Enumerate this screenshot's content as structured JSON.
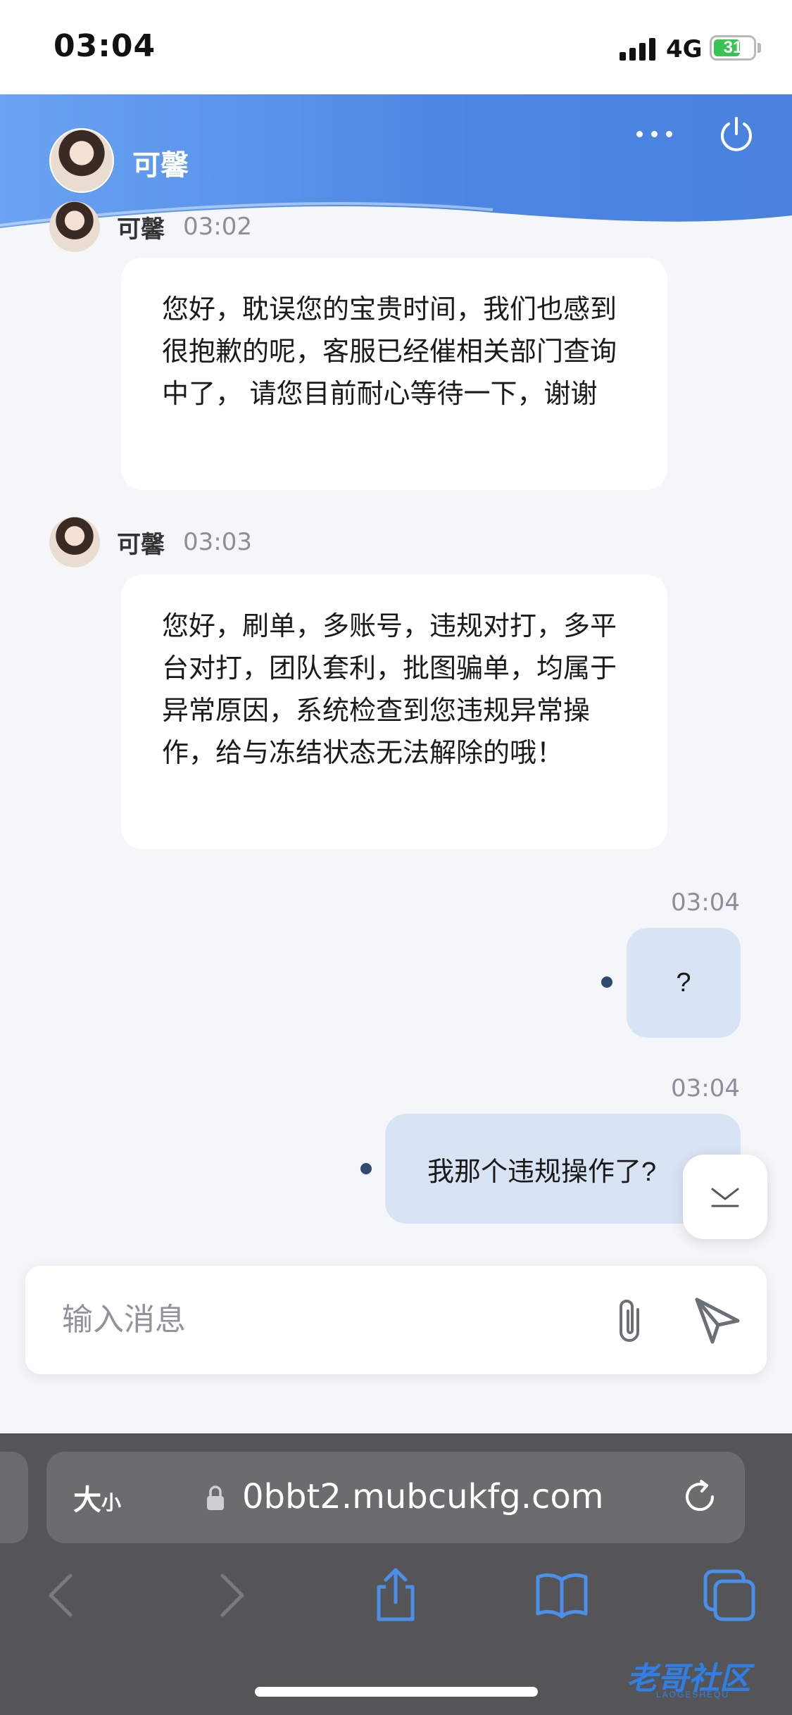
{
  "status_bar": {
    "time": "03:04",
    "network": "4G",
    "battery": "31"
  },
  "header": {
    "agent_name": "可馨"
  },
  "messages": [
    {
      "sender": "可馨",
      "time": "03:02",
      "text": "您好，耽误您的宝贵时间，我们也感到很抱歉的呢，客服已经催相关部门查询中了， 请您目前耐心等待一下，谢谢"
    },
    {
      "sender": "可馨",
      "time": "03:03",
      "text": "您好，刷单，多账号，违规对打，多平台对打，团队套利，批图骗单，均属于异常原因，系统检查到您违规异常操作，给与冻结状态无法解除的哦！"
    },
    {
      "time": "03:04",
      "text": "?"
    },
    {
      "time": "03:04",
      "text": "我那个违规操作了?"
    }
  ],
  "composer": {
    "placeholder": "输入消息"
  },
  "browser": {
    "text_size_label": "大",
    "text_size_small": "小",
    "url": "0bbt2.mubcukfg.com"
  },
  "watermark": {
    "text": "老哥社区",
    "sub": "LAOGESHEQU"
  },
  "colors": {
    "header_accent": "#4c86e2",
    "outgoing_bubble": "#d8e3f4",
    "read_dot": "#2f4a6e"
  },
  "icons": [
    "more-icon",
    "power-icon",
    "attach-icon",
    "send-icon",
    "scroll-down-icon",
    "lock-icon",
    "reload-icon",
    "back-icon",
    "forward-icon",
    "share-icon",
    "bookmarks-icon",
    "tabs-icon"
  ]
}
